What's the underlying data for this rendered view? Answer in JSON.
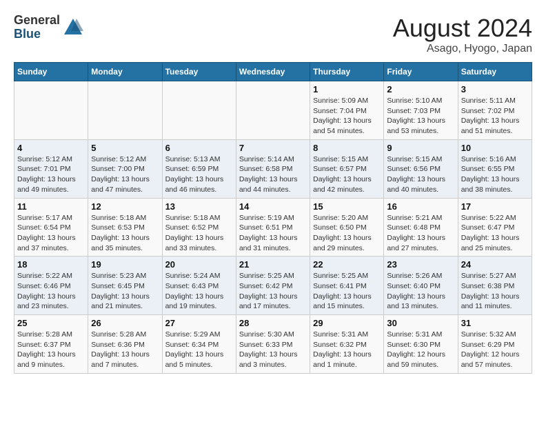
{
  "header": {
    "logo_general": "General",
    "logo_blue": "Blue",
    "month_title": "August 2024",
    "location": "Asago, Hyogo, Japan"
  },
  "days_of_week": [
    "Sunday",
    "Monday",
    "Tuesday",
    "Wednesday",
    "Thursday",
    "Friday",
    "Saturday"
  ],
  "weeks": [
    [
      {
        "day": "",
        "info": ""
      },
      {
        "day": "",
        "info": ""
      },
      {
        "day": "",
        "info": ""
      },
      {
        "day": "",
        "info": ""
      },
      {
        "day": "1",
        "info": "Sunrise: 5:09 AM\nSunset: 7:04 PM\nDaylight: 13 hours\nand 54 minutes."
      },
      {
        "day": "2",
        "info": "Sunrise: 5:10 AM\nSunset: 7:03 PM\nDaylight: 13 hours\nand 53 minutes."
      },
      {
        "day": "3",
        "info": "Sunrise: 5:11 AM\nSunset: 7:02 PM\nDaylight: 13 hours\nand 51 minutes."
      }
    ],
    [
      {
        "day": "4",
        "info": "Sunrise: 5:12 AM\nSunset: 7:01 PM\nDaylight: 13 hours\nand 49 minutes."
      },
      {
        "day": "5",
        "info": "Sunrise: 5:12 AM\nSunset: 7:00 PM\nDaylight: 13 hours\nand 47 minutes."
      },
      {
        "day": "6",
        "info": "Sunrise: 5:13 AM\nSunset: 6:59 PM\nDaylight: 13 hours\nand 46 minutes."
      },
      {
        "day": "7",
        "info": "Sunrise: 5:14 AM\nSunset: 6:58 PM\nDaylight: 13 hours\nand 44 minutes."
      },
      {
        "day": "8",
        "info": "Sunrise: 5:15 AM\nSunset: 6:57 PM\nDaylight: 13 hours\nand 42 minutes."
      },
      {
        "day": "9",
        "info": "Sunrise: 5:15 AM\nSunset: 6:56 PM\nDaylight: 13 hours\nand 40 minutes."
      },
      {
        "day": "10",
        "info": "Sunrise: 5:16 AM\nSunset: 6:55 PM\nDaylight: 13 hours\nand 38 minutes."
      }
    ],
    [
      {
        "day": "11",
        "info": "Sunrise: 5:17 AM\nSunset: 6:54 PM\nDaylight: 13 hours\nand 37 minutes."
      },
      {
        "day": "12",
        "info": "Sunrise: 5:18 AM\nSunset: 6:53 PM\nDaylight: 13 hours\nand 35 minutes."
      },
      {
        "day": "13",
        "info": "Sunrise: 5:18 AM\nSunset: 6:52 PM\nDaylight: 13 hours\nand 33 minutes."
      },
      {
        "day": "14",
        "info": "Sunrise: 5:19 AM\nSunset: 6:51 PM\nDaylight: 13 hours\nand 31 minutes."
      },
      {
        "day": "15",
        "info": "Sunrise: 5:20 AM\nSunset: 6:50 PM\nDaylight: 13 hours\nand 29 minutes."
      },
      {
        "day": "16",
        "info": "Sunrise: 5:21 AM\nSunset: 6:48 PM\nDaylight: 13 hours\nand 27 minutes."
      },
      {
        "day": "17",
        "info": "Sunrise: 5:22 AM\nSunset: 6:47 PM\nDaylight: 13 hours\nand 25 minutes."
      }
    ],
    [
      {
        "day": "18",
        "info": "Sunrise: 5:22 AM\nSunset: 6:46 PM\nDaylight: 13 hours\nand 23 minutes."
      },
      {
        "day": "19",
        "info": "Sunrise: 5:23 AM\nSunset: 6:45 PM\nDaylight: 13 hours\nand 21 minutes."
      },
      {
        "day": "20",
        "info": "Sunrise: 5:24 AM\nSunset: 6:43 PM\nDaylight: 13 hours\nand 19 minutes."
      },
      {
        "day": "21",
        "info": "Sunrise: 5:25 AM\nSunset: 6:42 PM\nDaylight: 13 hours\nand 17 minutes."
      },
      {
        "day": "22",
        "info": "Sunrise: 5:25 AM\nSunset: 6:41 PM\nDaylight: 13 hours\nand 15 minutes."
      },
      {
        "day": "23",
        "info": "Sunrise: 5:26 AM\nSunset: 6:40 PM\nDaylight: 13 hours\nand 13 minutes."
      },
      {
        "day": "24",
        "info": "Sunrise: 5:27 AM\nSunset: 6:38 PM\nDaylight: 13 hours\nand 11 minutes."
      }
    ],
    [
      {
        "day": "25",
        "info": "Sunrise: 5:28 AM\nSunset: 6:37 PM\nDaylight: 13 hours\nand 9 minutes."
      },
      {
        "day": "26",
        "info": "Sunrise: 5:28 AM\nSunset: 6:36 PM\nDaylight: 13 hours\nand 7 minutes."
      },
      {
        "day": "27",
        "info": "Sunrise: 5:29 AM\nSunset: 6:34 PM\nDaylight: 13 hours\nand 5 minutes."
      },
      {
        "day": "28",
        "info": "Sunrise: 5:30 AM\nSunset: 6:33 PM\nDaylight: 13 hours\nand 3 minutes."
      },
      {
        "day": "29",
        "info": "Sunrise: 5:31 AM\nSunset: 6:32 PM\nDaylight: 13 hours\nand 1 minute."
      },
      {
        "day": "30",
        "info": "Sunrise: 5:31 AM\nSunset: 6:30 PM\nDaylight: 12 hours\nand 59 minutes."
      },
      {
        "day": "31",
        "info": "Sunrise: 5:32 AM\nSunset: 6:29 PM\nDaylight: 12 hours\nand 57 minutes."
      }
    ]
  ]
}
